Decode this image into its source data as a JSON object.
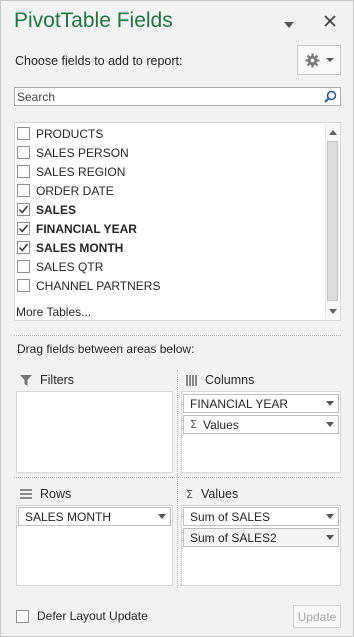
{
  "panel": {
    "title": "PivotTable Fields",
    "accent_color": "#217346"
  },
  "chooser": {
    "label": "Choose fields to add to report:",
    "tools_icon": "gear-icon"
  },
  "search": {
    "placeholder": "Search"
  },
  "fields": [
    {
      "label": "PRODUCTS",
      "checked": false
    },
    {
      "label": "SALES PERSON",
      "checked": false
    },
    {
      "label": "SALES REGION",
      "checked": false
    },
    {
      "label": "ORDER DATE",
      "checked": false
    },
    {
      "label": "SALES",
      "checked": true
    },
    {
      "label": "FINANCIAL YEAR",
      "checked": true
    },
    {
      "label": "SALES MONTH",
      "checked": true
    },
    {
      "label": "SALES QTR",
      "checked": false
    },
    {
      "label": "CHANNEL PARTNERS",
      "checked": false
    }
  ],
  "more_tables": "More Tables...",
  "drag_hint": "Drag fields between areas below:",
  "areas": {
    "filters": {
      "label": "Filters",
      "items": []
    },
    "columns": {
      "label": "Columns",
      "items": [
        "FINANCIAL YEAR",
        "Values"
      ]
    },
    "rows": {
      "label": "Rows",
      "items": [
        "SALES MONTH"
      ]
    },
    "values": {
      "label": "Values",
      "items": [
        "Sum of SALES",
        "Sum of SALES2"
      ]
    }
  },
  "values_symbol": "Σ",
  "footer": {
    "defer_label": "Defer Layout Update",
    "defer_checked": false,
    "update_label": "Update"
  }
}
